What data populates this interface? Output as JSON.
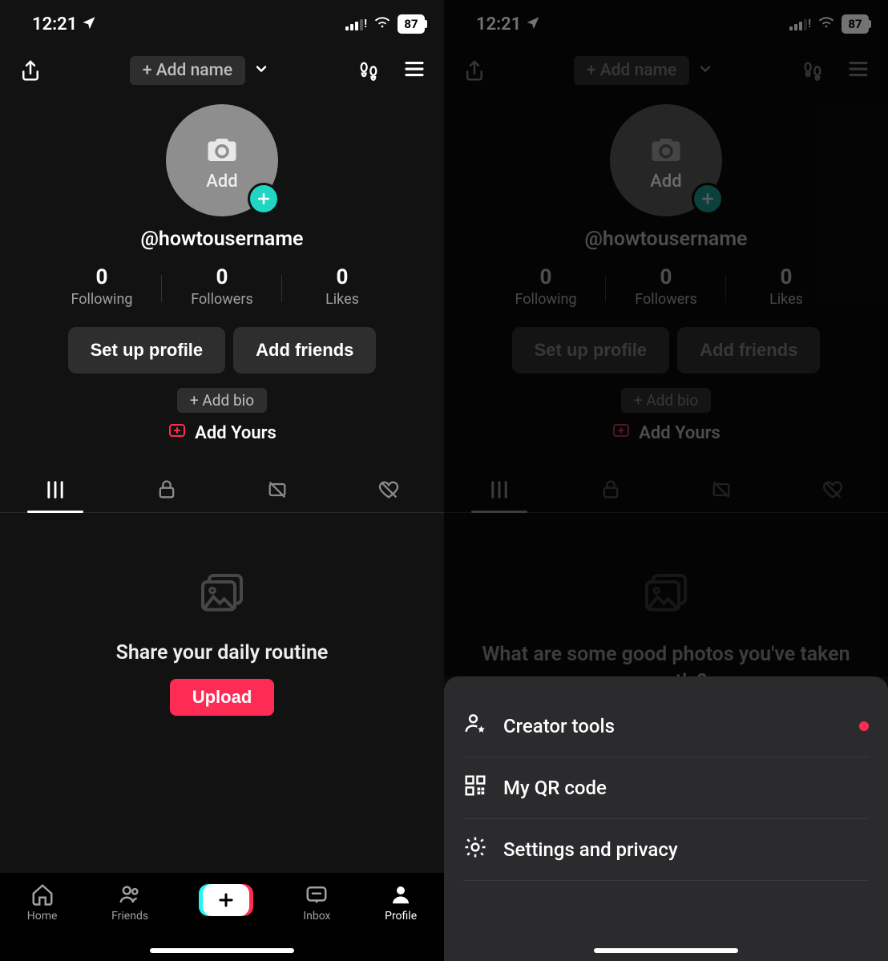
{
  "status": {
    "time": "12:21",
    "battery": "87"
  },
  "header": {
    "add_name": "+ Add name"
  },
  "profile": {
    "avatar_add": "Add",
    "username": "@howtousername",
    "stats": [
      {
        "num": "0",
        "lbl": "Following"
      },
      {
        "num": "0",
        "lbl": "Followers"
      },
      {
        "num": "0",
        "lbl": "Likes"
      }
    ],
    "setup_btn": "Set up profile",
    "add_friends_btn": "Add friends",
    "add_bio": "+ Add bio",
    "add_yours": "Add Yours"
  },
  "tabs": [
    "grid",
    "private",
    "repost",
    "liked"
  ],
  "empty_left": {
    "title": "Share your daily routine",
    "upload": "Upload"
  },
  "empty_right": {
    "title": "What are some good photos you've taken recently?"
  },
  "nav": {
    "home": "Home",
    "friends": "Friends",
    "inbox": "Inbox",
    "profile": "Profile"
  },
  "sheet": {
    "creator_tools": "Creator tools",
    "qr": "My QR code",
    "settings": "Settings and privacy"
  }
}
